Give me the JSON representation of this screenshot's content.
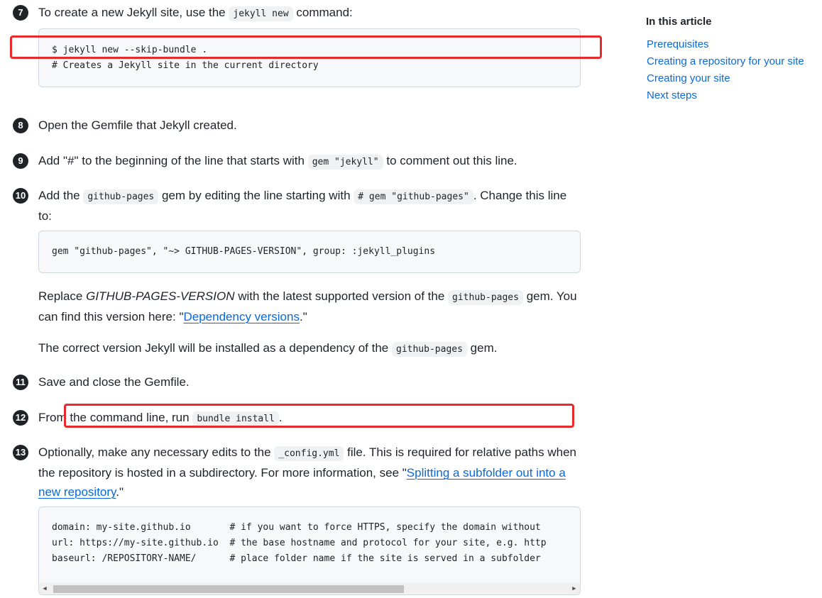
{
  "toc": {
    "title": "In this article",
    "items": [
      "Prerequisites",
      "Creating a repository for your site",
      "Creating your site",
      "Next steps"
    ]
  },
  "steps": {
    "s7": {
      "num": "7",
      "pre": "To create a new Jekyll site, use the",
      "code": "jekyll new",
      "post": "command:"
    },
    "s7_block": [
      "$ jekyll new --skip-bundle .",
      "# Creates a Jekyll site in the current directory"
    ],
    "s8": {
      "num": "8",
      "text": "Open the Gemfile that Jekyll created."
    },
    "s9": {
      "num": "9",
      "pre": "Add \"#\" to the beginning of the line that starts with",
      "code": "gem \"jekyll\"",
      "post": "to comment out this line."
    },
    "s10": {
      "num": "10",
      "p1": "Add the",
      "code1": "github-pages",
      "p2": "gem by editing the line starting with",
      "code2": "# gem \"github-pages\"",
      "p3": ". Change this line to:"
    },
    "s10_block": "gem \"github-pages\", \"~> GITHUB-PAGES-VERSION\", group: :jekyll_plugins",
    "s10_para1": {
      "p1": "Replace",
      "em": "GITHUB-PAGES-VERSION",
      "p2": "with the latest supported version of the",
      "code": "github-pages",
      "p3": "gem. You can find this version here: \"",
      "link": "Dependency versions",
      "p4": ".\""
    },
    "s10_para2": {
      "p1": "The correct version Jekyll will be installed as a dependency of the",
      "code": "github-pages",
      "p2": "gem."
    },
    "s11": {
      "num": "11",
      "text": "Save and close the Gemfile."
    },
    "s12": {
      "num": "12",
      "pre": "From the command line, run",
      "code": "bundle install",
      "post": "."
    },
    "s13": {
      "num": "13",
      "p1": "Optionally, make any necessary edits to the",
      "code": "_config.yml",
      "p2": "file. This is required for relative paths when the repository is hosted in a subdirectory. For more information, see \"",
      "link": "Splitting a subfolder out into a new repository",
      "p3": ".\""
    },
    "s13_block": [
      "domain: my-site.github.io       # if you want to force HTTPS, specify the domain without",
      "url: https://my-site.github.io  # the base hostname and protocol for your site, e.g. http",
      "baseurl: /REPOSITORY-NAME/      # place folder name if the site is served in a subfolder"
    ]
  },
  "scrollbar": {
    "left_arrow": "◀",
    "right_arrow": "▶"
  },
  "colors": {
    "link": "#0969da",
    "highlight": "#e52b2b",
    "code_bg": "#f6f8fa"
  }
}
